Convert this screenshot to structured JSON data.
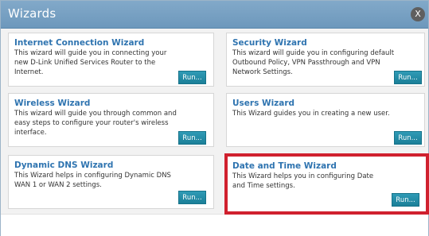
{
  "dialog": {
    "title": "Wizards",
    "close_label": "X"
  },
  "wizards": [
    {
      "title": "Internet Connection Wizard",
      "description": "This wizard will guide you in connecting your new D-Link Unified Services Router to the Internet.",
      "button_label": "Run..."
    },
    {
      "title": "Security Wizard",
      "description": "This wizard will guide you in configuring default Outbound Policy, VPN Passthrough and VPN Network Settings.",
      "button_label": "Run..."
    },
    {
      "title": "Wireless Wizard",
      "description": "This wizard will guide you through common and easy steps to configure your router's wireless interface.",
      "button_label": "Run..."
    },
    {
      "title": "Users Wizard",
      "description": "This Wizard guides you in creating a new user.",
      "button_label": "Run..."
    },
    {
      "title": "Dynamic DNS Wizard",
      "description": "This Wizard helps in configuring Dynamic DNS WAN 1 or WAN 2 settings.",
      "button_label": "Run..."
    },
    {
      "title": "Date and Time Wizard",
      "description": "This Wizard helps you in configuring Date and Time settings.",
      "button_label": "Run..."
    }
  ],
  "highlight_color": "#d0202e",
  "accent_color": "#2f74b0"
}
